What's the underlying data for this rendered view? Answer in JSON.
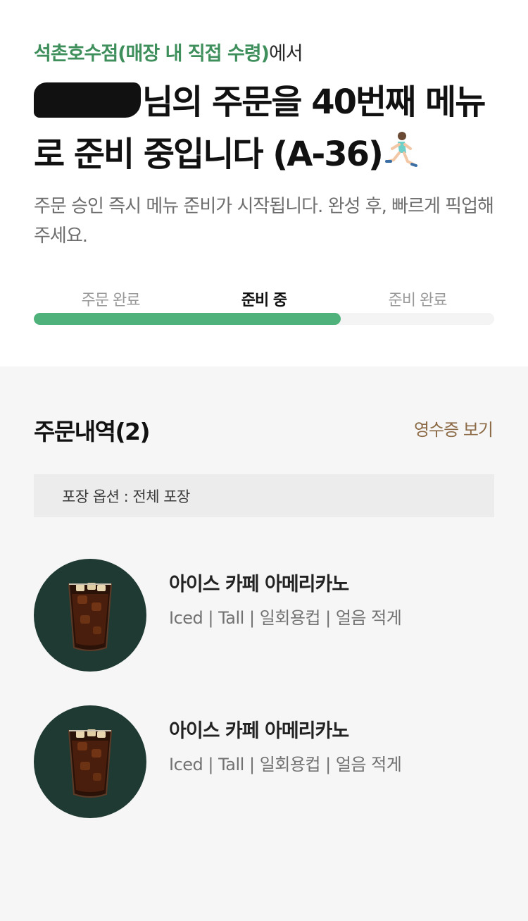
{
  "store": {
    "name": "석촌호수점(매장 내 직접 수령)",
    "suffix": "에서"
  },
  "headline": {
    "after_redaction": "님의 주문을 40번째 메뉴로 준비 중입니다 (A-36)"
  },
  "subtext": "주문 승인 즉시 메뉴 준비가 시작됩니다. 완성 후, 빠르게 픽업해 주세요.",
  "progress": {
    "steps": [
      "주문 완료",
      "준비 중",
      "준비 완료"
    ],
    "active_index": 1,
    "fill_percent": 66.7
  },
  "order": {
    "title": "주문내역(2)",
    "receipt_link": "영수증 보기",
    "pack_option": "포장 옵션 : 전체 포장",
    "items": [
      {
        "name": "아이스 카페 아메리카노",
        "options": "Iced | Tall | 일회용컵 | 얼음 적게",
        "icon": "iced-coffee-cup-icon"
      },
      {
        "name": "아이스 카페 아메리카노",
        "options": "Iced | Tall | 일회용컵 | 얼음 적게",
        "icon": "iced-coffee-cup-icon"
      }
    ]
  },
  "colors": {
    "accent_green": "#3f8f5c",
    "progress_green": "#4fb27a",
    "receipt_brown": "#8b6a45",
    "thumb_bg": "#1f3a33"
  }
}
